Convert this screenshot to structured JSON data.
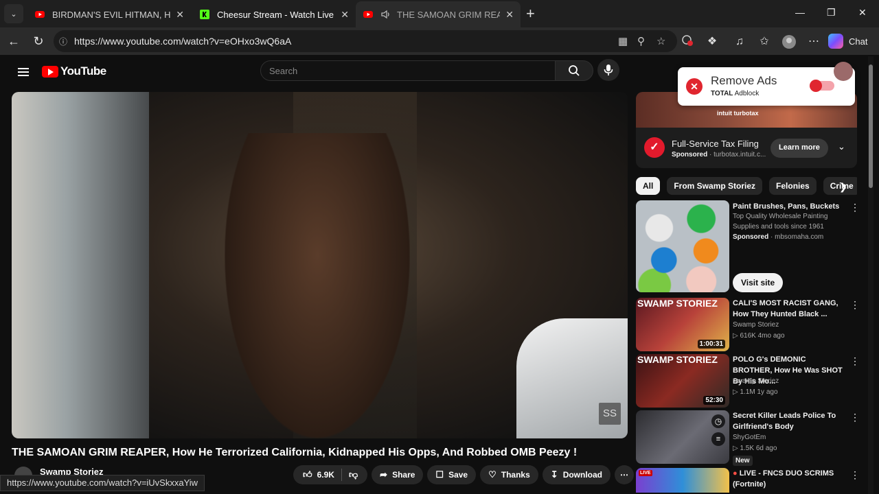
{
  "browser": {
    "tabs": [
      {
        "title": "BIRDMAN'S EVIL HITMAN, How H",
        "favicon": "youtube-icon"
      },
      {
        "title": "Cheesur Stream - Watch Live on Ki",
        "favicon": "kick-icon"
      },
      {
        "title": "THE SAMOAN GRIM REAPER,",
        "favicon": "youtube-icon",
        "audio": "speaker-icon"
      }
    ],
    "url": "https://www.youtube.com/watch?v=eOHxo3wQ6aA",
    "chat_label": "Chat",
    "status_url": "https://www.youtube.com/watch?v=iUvSkxxaYiw"
  },
  "youtube": {
    "logo_text": "YouTube",
    "search_placeholder": "Search",
    "video_title": "THE SAMOAN GRIM REAPER, How He Terrorized California, Kidnapped His Opps, And Robbed OMB Peezy !",
    "channel": "Swamp Storiez",
    "watermark": "SS",
    "actions": {
      "likes": "6.9K",
      "share": "Share",
      "save": "Save",
      "thanks": "Thanks",
      "download": "Download"
    }
  },
  "popup": {
    "title": "Remove Ads",
    "brand_bold": "TOTAL",
    "brand_rest": "Adblock"
  },
  "ad": {
    "banner_text": "intuit turbotax",
    "title": "Full-Service Tax Filing",
    "sponsored": "Sponsored",
    "domain": "turbotax.intuit.c...",
    "cta": "Learn more"
  },
  "chips": [
    "All",
    "From Swamp Storiez",
    "Felonies",
    "Crime"
  ],
  "recommendations": [
    {
      "title": "Paint Brushes, Pans, Buckets",
      "desc1": "Top Quality Wholesale Painting",
      "desc2": "Supplies and tools since 1961",
      "sponsored": "Sponsored",
      "domain": "mbsomaha.com",
      "cta": "Visit site"
    },
    {
      "title": "CALI'S MOST RACIST GANG, How They Hunted Black ...",
      "channel": "Swamp Storiez",
      "meta": "616K   4mo ago",
      "duration": "1:00:31",
      "thumb_text": "SWAMP STORIEZ"
    },
    {
      "title": "POLO G's DEMONIC BROTHER, How He Was SHOT By His Mo...",
      "channel": "Swamp Storiez",
      "meta": "1.1M   1y ago",
      "duration": "52:30",
      "thumb_text": "SWAMP STORIEZ"
    },
    {
      "title": "Secret Killer Leads Police To Girlfriend's Body",
      "channel": "ShyGotEm",
      "meta": "1.5K   6d ago",
      "badge": "New"
    },
    {
      "title": "LIVE - FNCS DUO SCRIMS (Fortnite)",
      "live_badge": "LIVE"
    }
  ]
}
